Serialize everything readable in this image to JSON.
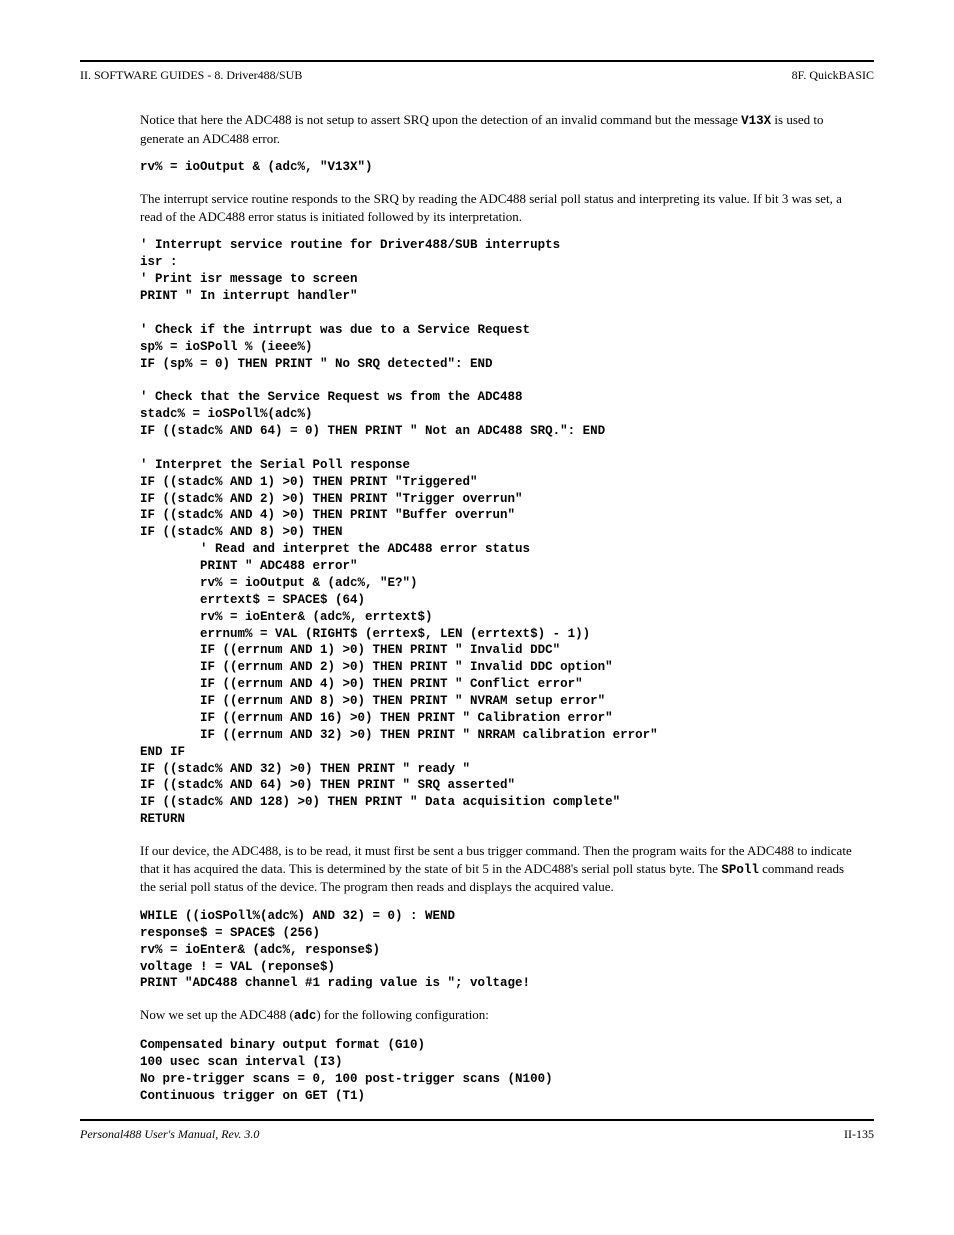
{
  "header": {
    "left": "II. SOFTWARE GUIDES - 8. Driver488/SUB",
    "right": "8F. QuickBASIC"
  },
  "intro_para": "Notice that here the ADC488 is not setup to assert SRQ upon the detection of an invalid command but the message ",
  "intro_code": "V13X",
  "intro_para_after": " is used to generate an ADC488 error.",
  "code1": "rv% = ioOutput & (adc%, \"V13X\")",
  "para2": "The interrupt service routine responds to the SRQ by reading the ADC488 serial poll status and interpreting its value. If bit 3 was set, a read of the ADC488 error status is initiated followed by its interpretation.",
  "code2": "' Interrupt service routine for Driver488/SUB interrupts\nisr :\n' Print isr message to screen\nPRINT \" In interrupt handler\"\n\n' Check if the intrrupt was due to a Service Request\nsp% = ioSPoll % (ieee%)\nIF (sp% = 0) THEN PRINT \" No SRQ detected\": END\n\n' Check that the Service Request ws from the ADC488\nstadc% = ioSPoll%(adc%)\nIF ((stadc% AND 64) = 0) THEN PRINT \" Not an ADC488 SRQ.\": END\n\n' Interpret the Serial Poll response\nIF ((stadc% AND 1) >0) THEN PRINT \"Triggered\"\nIF ((stadc% AND 2) >0) THEN PRINT \"Trigger overrun\"\nIF ((stadc% AND 4) >0) THEN PRINT \"Buffer overrun\"\nIF ((stadc% AND 8) >0) THEN\n        ' Read and interpret the ADC488 error status\n        PRINT \" ADC488 error\"\n        rv% = ioOutput & (adc%, \"E?\")\n        errtext$ = SPACE$ (64)\n        rv% = ioEnter& (adc%, errtext$)\n        errnum% = VAL (RIGHT$ (errtex$, LEN (errtext$) - 1))\n        IF ((errnum AND 1) >0) THEN PRINT \" Invalid DDC\"\n        IF ((errnum AND 2) >0) THEN PRINT \" Invalid DDC option\"\n        IF ((errnum AND 4) >0) THEN PRINT \" Conflict error\"\n        IF ((errnum AND 8) >0) THEN PRINT \" NVRAM setup error\"\n        IF ((errnum AND 16) >0) THEN PRINT \" Calibration error\"\n        IF ((errnum AND 32) >0) THEN PRINT \" NRRAM calibration error\"\nEND IF\nIF ((stadc% AND 32) >0) THEN PRINT \" ready \"\nIF ((stadc% AND 64) >0) THEN PRINT \" SRQ asserted\"\nIF ((stadc% AND 128) >0) THEN PRINT \" Data acquisition complete\"\nRETURN",
  "para3_a": "If our device, the ADC488, is to be read, it must first be sent a bus trigger command. Then the program waits for the ADC488 to indicate that it has acquired the data. This is determined by the state of bit 5 in the ADC488's serial poll status byte. The ",
  "para3_code": "SPoll",
  "para3_b": " command reads the serial poll status of the device. The program then reads and displays the acquired value.",
  "code3": "WHILE ((ioSPoll%(adc%) AND 32) = 0) : WEND\nresponse$ = SPACE$ (256)\nrv% = ioEnter& (adc%, response$)\nvoltage ! = VAL (reponse$)\nPRINT \"ADC488 channel #1 rading value is \"; voltage!",
  "para4_a": "Now we set up the ADC488 (",
  "para4_code": "adc",
  "para4_b": ") for the following configuration:",
  "code4": "Compensated binary output format (G10)\n100 usec scan interval (I3)\nNo pre-trigger scans = 0, 100 post-trigger scans (N100)\nContinuous trigger on GET (T1)",
  "footer": {
    "left": "Personal488 User's Manual, Rev. 3.0",
    "right": "II-135"
  }
}
